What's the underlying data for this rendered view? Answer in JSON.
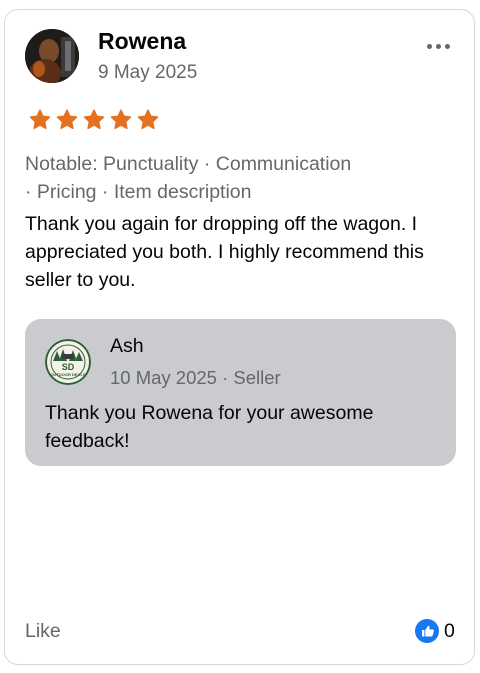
{
  "reviewer": {
    "name": "Rowena",
    "date": "9 May 2025",
    "rating": 5,
    "max_rating": 5
  },
  "notable": {
    "line1": "Notable: Punctuality · Communication",
    "line2": "· Pricing · Item description"
  },
  "review": {
    "text": "Thank you again for dropping off the wagon. I appreciated you both. I highly recommend this seller to you."
  },
  "reply": {
    "name": "Ash",
    "meta": "10 May 2025 · Seller",
    "text": "Thank you Rowena for your awesome feedback!",
    "logo_text": "SD",
    "logo_subtext": "OUTDOOR DEALS"
  },
  "footer": {
    "like_label": "Like",
    "like_count": "0"
  },
  "colors": {
    "star": "#e4711f",
    "like_blue": "#1877f2",
    "reply_bg": "#c9cbcf"
  },
  "icons": {
    "more": "more-horizontal-icon",
    "star": "star-icon",
    "like": "thumbs-up-icon"
  }
}
